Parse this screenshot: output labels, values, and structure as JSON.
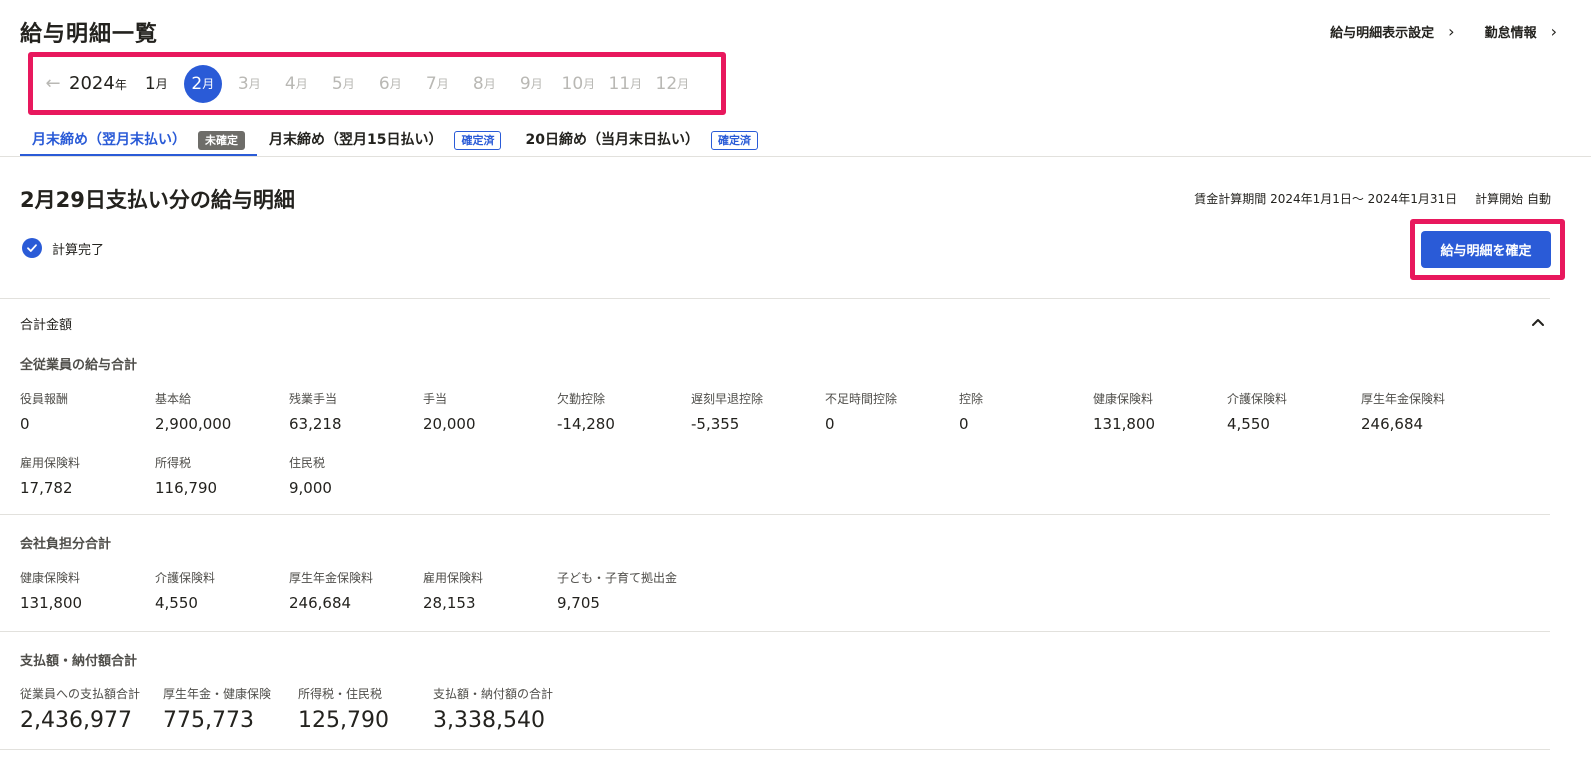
{
  "header": {
    "title": "給与明細一覧",
    "links": [
      {
        "label": "給与明細表示設定"
      },
      {
        "label": "勤怠情報"
      }
    ]
  },
  "month_nav": {
    "year": "2024",
    "year_unit": "年",
    "month_unit": "月",
    "months": [
      "1",
      "2",
      "3",
      "4",
      "5",
      "6",
      "7",
      "8",
      "9",
      "10",
      "11",
      "12"
    ],
    "selected": "2"
  },
  "tabs": [
    {
      "label": "月末締め（翌月末払い）",
      "badge": "未確定",
      "status": "pending"
    },
    {
      "label": "月末締め（翌月15日払い）",
      "badge": "確定済",
      "status": "done"
    },
    {
      "label": "20日締め（当月末日払い）",
      "badge": "確定済",
      "status": "done"
    }
  ],
  "pay": {
    "title": "2月29日支払い分の給与明細",
    "period_label": "賃金計算期間",
    "period_value": "2024年1月1日～ 2024年1月31日",
    "calc_start_label": "計算開始",
    "calc_start_value": "自動",
    "status": "計算完了",
    "confirm_label": "給与明細を確定"
  },
  "summary": {
    "title": "合計金額",
    "employee": {
      "title": "全従業員の給与合計",
      "items": [
        {
          "label": "役員報酬",
          "value": "0"
        },
        {
          "label": "基本給",
          "value": "2,900,000"
        },
        {
          "label": "残業手当",
          "value": "63,218"
        },
        {
          "label": "手当",
          "value": "20,000"
        },
        {
          "label": "欠勤控除",
          "value": "-14,280"
        },
        {
          "label": "遅刻早退控除",
          "value": "-5,355"
        },
        {
          "label": "不足時間控除",
          "value": "0"
        },
        {
          "label": "控除",
          "value": "0"
        },
        {
          "label": "健康保険料",
          "value": "131,800"
        },
        {
          "label": "介護保険料",
          "value": "4,550"
        },
        {
          "label": "厚生年金保険料",
          "value": "246,684"
        },
        {
          "label": "雇用保険料",
          "value": "17,782"
        },
        {
          "label": "所得税",
          "value": "116,790"
        },
        {
          "label": "住民税",
          "value": "9,000"
        }
      ]
    },
    "company": {
      "title": "会社負担分合計",
      "items": [
        {
          "label": "健康保険料",
          "value": "131,800"
        },
        {
          "label": "介護保険料",
          "value": "4,550"
        },
        {
          "label": "厚生年金保険料",
          "value": "246,684"
        },
        {
          "label": "雇用保険料",
          "value": "28,153"
        },
        {
          "label": "子ども・子育て拠出金",
          "value": "9,705"
        }
      ]
    },
    "payment": {
      "title": "支払額・納付額合計",
      "items": [
        {
          "label": "従業員への支払額合計",
          "value": "2,436,977"
        },
        {
          "label": "厚生年金・健康保険",
          "value": "775,773"
        },
        {
          "label": "所得税・住民税",
          "value": "125,790"
        },
        {
          "label": "支払額・納付額の合計",
          "value": "3,338,540"
        }
      ]
    }
  },
  "colors": {
    "accent": "#2a5bd7",
    "highlight_frame": "#e8185d",
    "badge_pending": "#6e6d69"
  }
}
